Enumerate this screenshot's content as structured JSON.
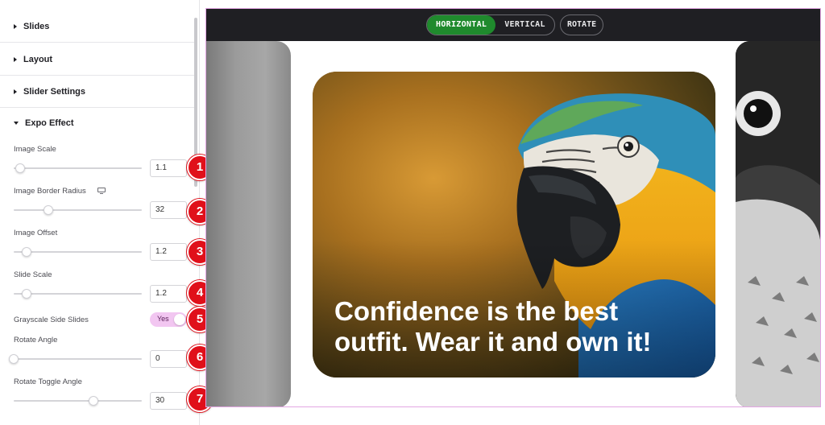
{
  "panel": {
    "sections": [
      {
        "label": "Slides",
        "open": false
      },
      {
        "label": "Layout",
        "open": false
      },
      {
        "label": "Slider Settings",
        "open": false
      },
      {
        "label": "Expo Effect",
        "open": true
      }
    ],
    "controls": [
      {
        "label": "Image Scale",
        "value": "1.1",
        "slider_fraction": 0.05
      },
      {
        "label": "Image Border Radius",
        "value": "32",
        "slider_fraction": 0.27
      },
      {
        "label": "Image Offset",
        "value": "1.2",
        "slider_fraction": 0.1
      },
      {
        "label": "Slide Scale",
        "value": "1.2",
        "slider_fraction": 0.1
      },
      {
        "label": "Grayscale Side Slides",
        "toggle": "Yes"
      },
      {
        "label": "Rotate Angle",
        "value": "0",
        "slider_fraction": 0.0
      },
      {
        "label": "Rotate Toggle Angle",
        "value": "30",
        "slider_fraction": 0.62
      }
    ],
    "badges": [
      "1",
      "2",
      "3",
      "4",
      "5",
      "6",
      "7"
    ]
  },
  "preview": {
    "tabs": [
      {
        "label": "HORIZONTAL",
        "active": true
      },
      {
        "label": "VERTICAL",
        "active": false
      }
    ],
    "rotate_label": "ROTATE",
    "slide_text": "Confidence is the best outfit. Wear it and own it!"
  },
  "colors": {
    "active_tab": "#1f8a2d",
    "badge": "#e0101a",
    "toggle_on": "#f2c6f1",
    "preview_border": "#e3a6e3"
  }
}
